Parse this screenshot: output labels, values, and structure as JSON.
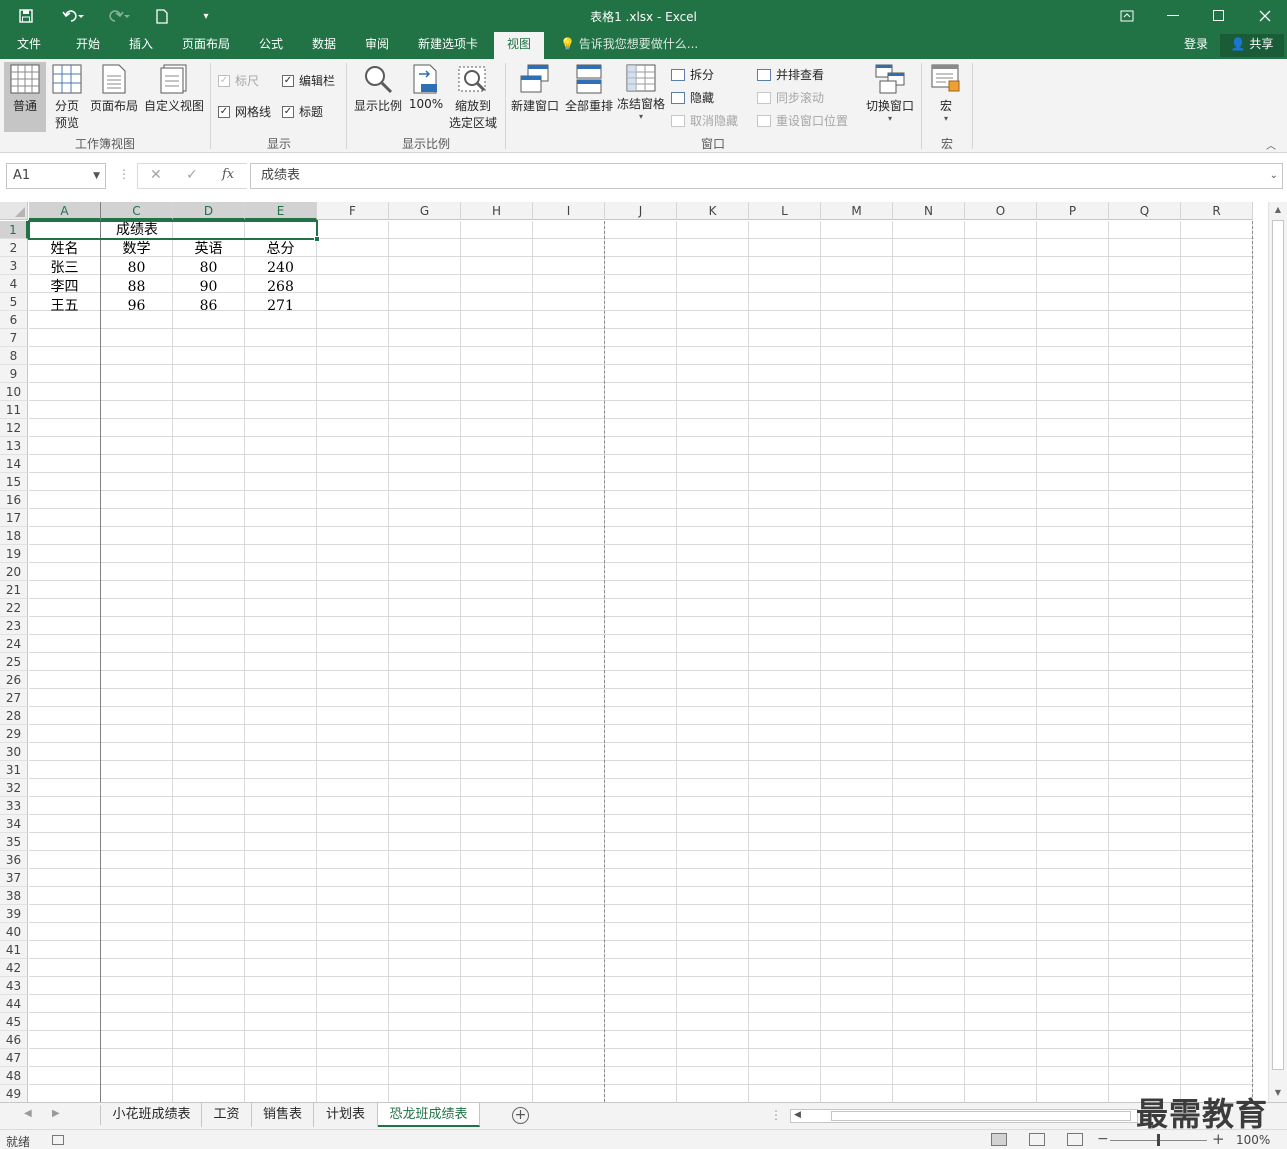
{
  "titlebar": {
    "title": "表格1 .xlsx - Excel",
    "save_icon": "save-icon",
    "undo_icon": "undo-icon",
    "redo_icon": "redo-icon",
    "new_icon": "new-file-icon"
  },
  "ribbon_tabs": [
    {
      "label": "文件"
    },
    {
      "label": "开始"
    },
    {
      "label": "插入"
    },
    {
      "label": "页面布局"
    },
    {
      "label": "公式"
    },
    {
      "label": "数据"
    },
    {
      "label": "审阅"
    },
    {
      "label": "新建选项卡"
    },
    {
      "label": "视图"
    }
  ],
  "active_tab": "视图",
  "tell_me": "告诉我您想要做什么...",
  "login": "登录",
  "share": "共享",
  "ribbon": {
    "workbook_views": {
      "label": "工作簿视图",
      "normal": "普通",
      "page_break_1": "分页",
      "page_break_2": "预览",
      "page_layout": "页面布局",
      "custom_views": "自定义视图"
    },
    "show": {
      "label": "显示",
      "ruler": "标尺",
      "formula_bar": "编辑栏",
      "gridlines": "网格线",
      "headings": "标题"
    },
    "zoom": {
      "label": "显示比例",
      "zoom": "显示比例",
      "hundred": "100%",
      "zoom_sel_1": "缩放到",
      "zoom_sel_2": "选定区域"
    },
    "window": {
      "label": "窗口",
      "new_window": "新建窗口",
      "arrange_all": "全部重排",
      "freeze_panes": "冻结窗格",
      "split": "拆分",
      "hide": "隐藏",
      "unhide": "取消隐藏",
      "side_by_side": "并排查看",
      "sync_scroll": "同步滚动",
      "reset_position": "重设窗口位置",
      "switch_windows": "切换窗口"
    },
    "macros": {
      "label": "宏",
      "macros": "宏"
    }
  },
  "formula_bar": {
    "name_box": "A1",
    "cancel_icon": "✕",
    "enter_icon": "✓",
    "fx": "fx",
    "content": "成绩表"
  },
  "columns": [
    "A",
    "C",
    "D",
    "E",
    "F",
    "G",
    "H",
    "I",
    "J",
    "K",
    "L",
    "M",
    "N",
    "O",
    "P",
    "Q",
    "R"
  ],
  "row_count": 49,
  "cells": {
    "title": "成绩表",
    "headers": [
      "姓名",
      "数学",
      "英语",
      "总分"
    ],
    "rows": [
      [
        "张三",
        "80",
        "80",
        "240"
      ],
      [
        "李四",
        "88",
        "90",
        "268"
      ],
      [
        "王五",
        "96",
        "86",
        "271"
      ]
    ]
  },
  "sheet_tabs": [
    {
      "label": "小花班成绩表"
    },
    {
      "label": "工资"
    },
    {
      "label": "销售表"
    },
    {
      "label": "计划表"
    },
    {
      "label": "恐龙班成绩表"
    }
  ],
  "active_sheet": "恐龙班成绩表",
  "watermark": "最需教育",
  "status": {
    "ready": "就绪",
    "zoom": "100%",
    "zoom_fraction": 0.5
  },
  "colors": {
    "accent": "#217346",
    "ribbon_bg": "#f3f3f3"
  }
}
